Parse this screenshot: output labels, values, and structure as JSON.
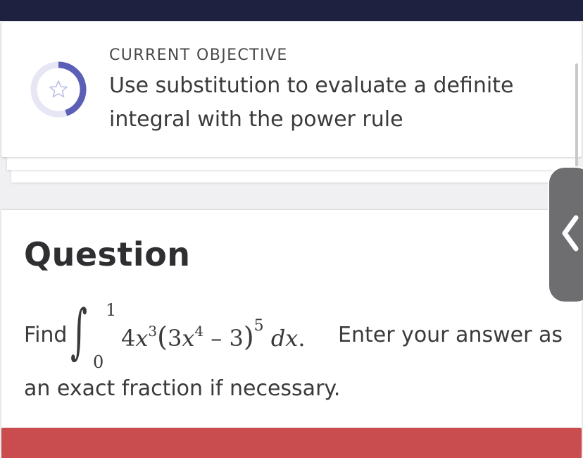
{
  "objective": {
    "label": "CURRENT OBJECTIVE",
    "text": "Use substitution to evaluate a definite integral with the power rule",
    "icon": "star-icon",
    "progress_fraction": 0.45,
    "accent": "#5b5fb6"
  },
  "question": {
    "title": "Question",
    "find_word": "Find",
    "integral": {
      "lower_limit": "0",
      "upper_limit": "1",
      "coef": "4",
      "var": "x",
      "exp1": "3",
      "inner_coef": "3",
      "exp2": "4",
      "minus": "–",
      "const": "3",
      "outer_exp": "5",
      "differential": "dx",
      "after_dot": "."
    },
    "line1_rest": "Enter your answer as",
    "line2": "an exact fraction if necessary."
  },
  "side_tab": {
    "icon": "chevron-left-icon"
  },
  "colors": {
    "topbar": "#1f2140",
    "red_bar": "#c94c4f",
    "tab": "#6e6e70"
  }
}
